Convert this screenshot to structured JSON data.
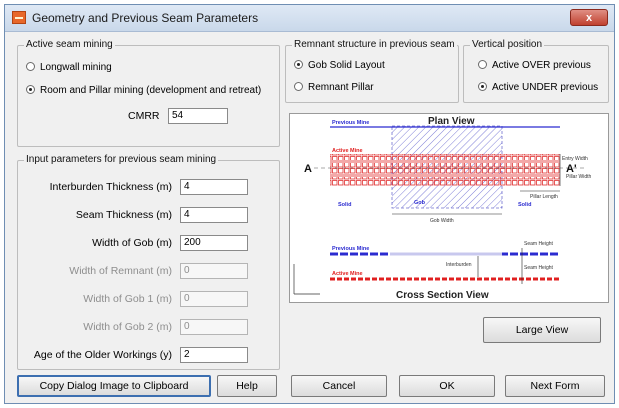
{
  "window": {
    "title": "Geometry and Previous Seam Parameters",
    "close_label": "x"
  },
  "active_seam": {
    "group_label": "Active seam mining",
    "options": [
      {
        "label": "Longwall mining",
        "checked": false
      },
      {
        "label": "Room and Pillar mining (development and retreat)",
        "checked": true
      }
    ],
    "cmrr_label": "CMRR",
    "cmrr_value": "54"
  },
  "remnant": {
    "group_label": "Remnant structure in previous seam",
    "options": [
      {
        "label": "Gob Solid Layout",
        "checked": true
      },
      {
        "label": "Remnant Pillar",
        "checked": false
      }
    ]
  },
  "vertical": {
    "group_label": "Vertical position",
    "options": [
      {
        "label": "Active OVER previous",
        "checked": false
      },
      {
        "label": "Active UNDER previous",
        "checked": true
      }
    ]
  },
  "previous_seam": {
    "group_label": "Input parameters for previous seam mining",
    "fields": [
      {
        "label": "Interburden Thickness (m)",
        "value": "4",
        "enabled": true
      },
      {
        "label": "Seam Thickness (m)",
        "value": "4",
        "enabled": true
      },
      {
        "label": "Width of Gob (m)",
        "value": "200",
        "enabled": true
      },
      {
        "label": "Width of Remnant (m)",
        "value": "0",
        "enabled": false
      },
      {
        "label": "Width of Gob 1 (m)",
        "value": "0",
        "enabled": false
      },
      {
        "label": "Width of Gob 2 (m)",
        "value": "0",
        "enabled": false
      },
      {
        "label": "Age of the Older Workings (y)",
        "value": "2",
        "enabled": true
      }
    ]
  },
  "diagram": {
    "plan_title": "Plan View",
    "section_title": "Cross Section View",
    "previous_mine": "Previous Mine",
    "active_mine": "Active Mine",
    "entry_width": "Entry Width",
    "pillar_width": "Pillar Width",
    "pillar_length": "Pillar Length",
    "gob": "Gob",
    "solid": "Solid",
    "gob_width": "Gob Width",
    "seam_height": "Seam Height",
    "interburden": "Interburden",
    "section_a": "A",
    "section_a_prime": "A'",
    "colors": {
      "previous": "#2b2bd0",
      "active": "#e02020",
      "gob_hatch": "#7070d0"
    }
  },
  "buttons": {
    "copy": "Copy Dialog Image to Clipboard",
    "help": "Help",
    "cancel": "Cancel",
    "ok": "OK",
    "next": "Next Form",
    "large_view": "Large View"
  }
}
